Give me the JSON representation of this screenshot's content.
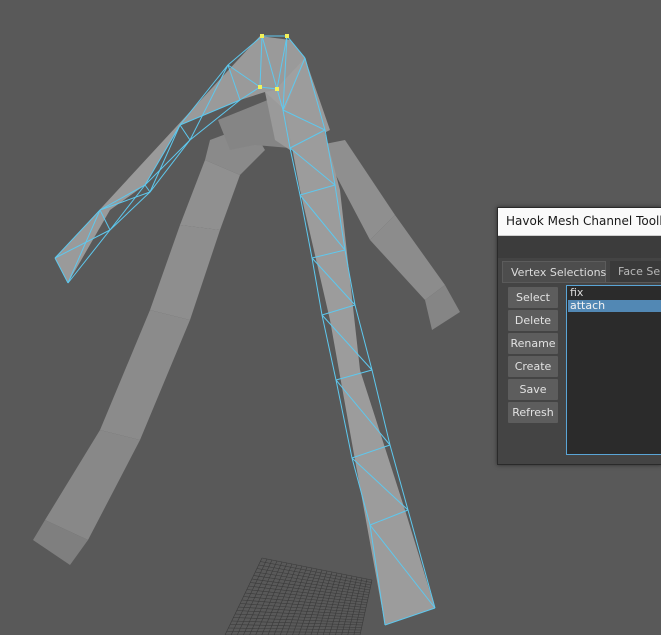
{
  "window": {
    "title": "Havok Mesh Channel Toolbox"
  },
  "tabs": [
    {
      "label": "Vertex Selections",
      "active": true
    },
    {
      "label": "Face Sel",
      "active": false
    }
  ],
  "buttons": {
    "select": "Select",
    "delete": "Delete",
    "rename": "Rename",
    "create": "Create",
    "save": "Save",
    "refresh": "Refresh"
  },
  "selection_list": {
    "items": [
      {
        "label": "fix",
        "selected": false
      },
      {
        "label": "attach",
        "selected": true
      }
    ]
  },
  "colors": {
    "viewport_background": "#595959",
    "wireframe_highlight": "#5ec8ee",
    "selected_vertex": "#f2f25a",
    "list_selection": "#5288b4"
  }
}
